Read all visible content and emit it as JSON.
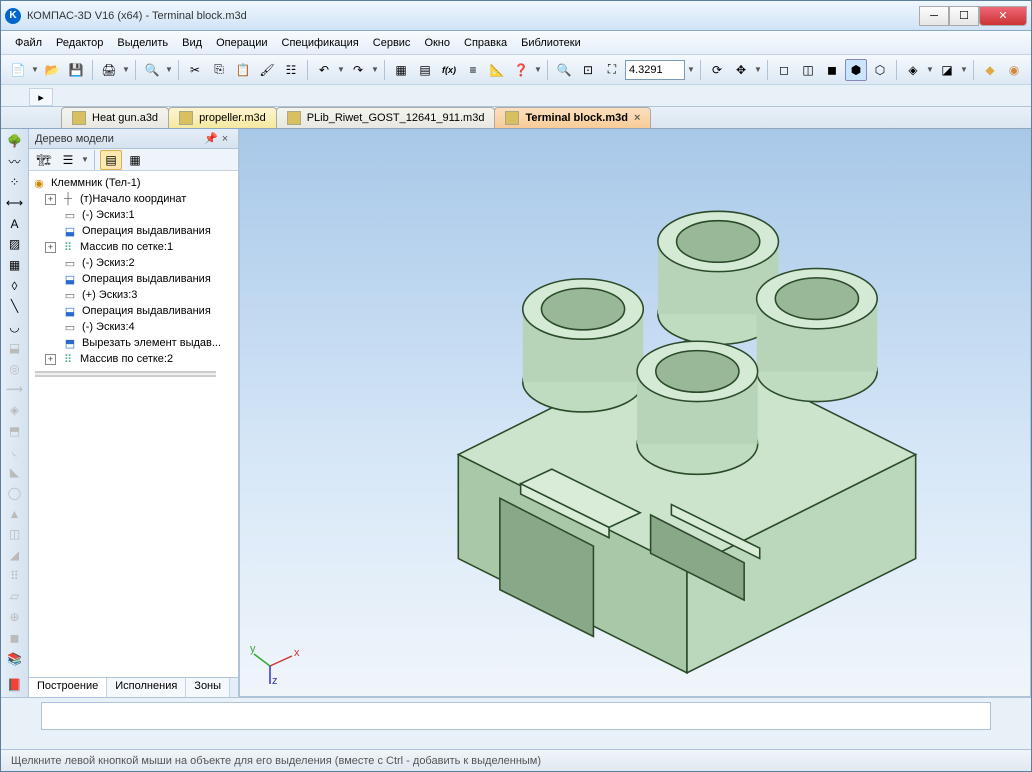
{
  "window": {
    "title": "КОМПАС-3D V16  (x64) - Terminal block.m3d"
  },
  "menu": [
    "Файл",
    "Редактор",
    "Выделить",
    "Вид",
    "Операции",
    "Спецификация",
    "Сервис",
    "Окно",
    "Справка",
    "Библиотеки"
  ],
  "zoom_value": "4.3291",
  "tabs": [
    {
      "label": "Heat gun.a3d",
      "active": false,
      "variant": "plain"
    },
    {
      "label": "propeller.m3d",
      "active": false,
      "variant": "yellow"
    },
    {
      "label": "PLib_Riwet_GOST_12641_911.m3d",
      "active": false,
      "variant": "plain"
    },
    {
      "label": "Terminal block.m3d",
      "active": true,
      "variant": "active"
    }
  ],
  "tree": {
    "title": "Дерево модели",
    "root": "Клеммник (Тел-1)",
    "nodes": [
      {
        "expand": "+",
        "icon": "axis",
        "label": "(т)Начало координат"
      },
      {
        "expand": "",
        "icon": "sketch",
        "label": "(-) Эскиз:1"
      },
      {
        "expand": "",
        "icon": "extrude",
        "label": "Операция выдавливания"
      },
      {
        "expand": "+",
        "icon": "pattern",
        "label": "Массив по сетке:1"
      },
      {
        "expand": "",
        "icon": "sketch",
        "label": "(-) Эскиз:2"
      },
      {
        "expand": "",
        "icon": "extrude",
        "label": "Операция выдавливания"
      },
      {
        "expand": "",
        "icon": "sketch",
        "label": "(+) Эскиз:3"
      },
      {
        "expand": "",
        "icon": "extrude",
        "label": "Операция выдавливания"
      },
      {
        "expand": "",
        "icon": "sketch",
        "label": "(-) Эскиз:4"
      },
      {
        "expand": "",
        "icon": "cut",
        "label": "Вырезать элемент выдав..."
      },
      {
        "expand": "+",
        "icon": "pattern",
        "label": "Массив по сетке:2"
      }
    ],
    "bottom_tabs": [
      "Построение",
      "Исполнения",
      "Зоны"
    ]
  },
  "status": "Щелкните левой кнопкой мыши на объекте для его выделения (вместе с Ctrl - добавить к выделенным)",
  "icons": {
    "sketch": "▭",
    "extrude": "⬓",
    "pattern": "⠿",
    "cut": "⬒",
    "axis": "┼",
    "root": "◉"
  }
}
